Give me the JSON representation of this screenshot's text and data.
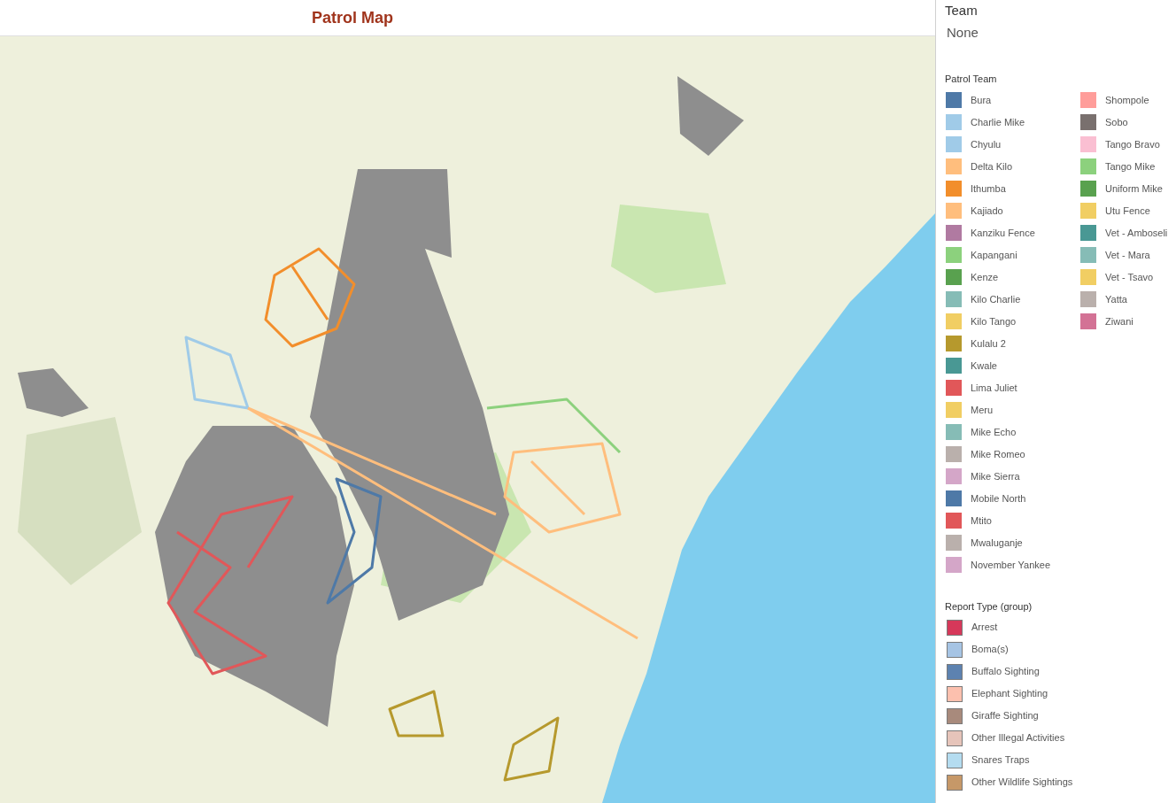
{
  "title": "Patrol Map",
  "filter": {
    "label": "Team",
    "value": "None"
  },
  "patrol_legend": {
    "title": "Patrol Team",
    "items": [
      {
        "label": "Bura",
        "color": "#4e79a7"
      },
      {
        "label": "Charlie Mike",
        "color": "#a0cbe8"
      },
      {
        "label": "Chyulu",
        "color": "#a0cbe8"
      },
      {
        "label": "Delta Kilo",
        "color": "#ffbe7d"
      },
      {
        "label": "Ithumba",
        "color": "#f28e2b"
      },
      {
        "label": "Kajiado",
        "color": "#ffbe7d"
      },
      {
        "label": "Kanziku Fence",
        "color": "#b07aa1"
      },
      {
        "label": "Kapangani",
        "color": "#8cd17d"
      },
      {
        "label": "Kenze",
        "color": "#59a14f"
      },
      {
        "label": "Kilo Charlie",
        "color": "#86bcb6"
      },
      {
        "label": "Kilo Tango",
        "color": "#f1ce63"
      },
      {
        "label": "Kulalu 2",
        "color": "#b6992d"
      },
      {
        "label": "Kwale",
        "color": "#499894"
      },
      {
        "label": "Lima Juliet",
        "color": "#e15759"
      },
      {
        "label": "Meru",
        "color": "#f1ce63"
      },
      {
        "label": "Mike Echo",
        "color": "#86bcb6"
      },
      {
        "label": "Mike Romeo",
        "color": "#bab0ac"
      },
      {
        "label": "Mike Sierra",
        "color": "#d4a6c8"
      },
      {
        "label": "Mobile North",
        "color": "#4e79a7"
      },
      {
        "label": "Mtito",
        "color": "#e15759"
      },
      {
        "label": "Mwaluganje",
        "color": "#bab0ac"
      },
      {
        "label": "November Yankee",
        "color": "#d4a6c8"
      },
      {
        "label": "Shompole",
        "color": "#ff9d9a"
      },
      {
        "label": "Sobo",
        "color": "#79706e"
      },
      {
        "label": "Tango Bravo",
        "color": "#fabfd2"
      },
      {
        "label": "Tango Mike",
        "color": "#8cd17d"
      },
      {
        "label": "Uniform Mike",
        "color": "#59a14f"
      },
      {
        "label": "Utu Fence",
        "color": "#f1ce63"
      },
      {
        "label": "Vet - Amboseli",
        "color": "#499894"
      },
      {
        "label": "Vet - Mara",
        "color": "#86bcb6"
      },
      {
        "label": "Vet - Tsavo",
        "color": "#f1ce63"
      },
      {
        "label": "Yatta",
        "color": "#bab0ac"
      },
      {
        "label": "Ziwani",
        "color": "#d37295"
      }
    ]
  },
  "report_legend": {
    "title": "Report Type (group)",
    "items": [
      {
        "label": "Arrest",
        "color": "#d6385a"
      },
      {
        "label": "Boma(s)",
        "color": "#a6c4e4"
      },
      {
        "label": "Buffalo Sighting",
        "color": "#5d82b0"
      },
      {
        "label": "Elephant Sighting",
        "color": "#fcc0ae"
      },
      {
        "label": "Giraffe Sighting",
        "color": "#a88a7c"
      },
      {
        "label": "Other Illegal Activities",
        "color": "#e6c4ba"
      },
      {
        "label": "Snares Traps",
        "color": "#b4dcf0"
      },
      {
        "label": "Other Wildlife Sightings",
        "color": "#c69868"
      }
    ]
  }
}
